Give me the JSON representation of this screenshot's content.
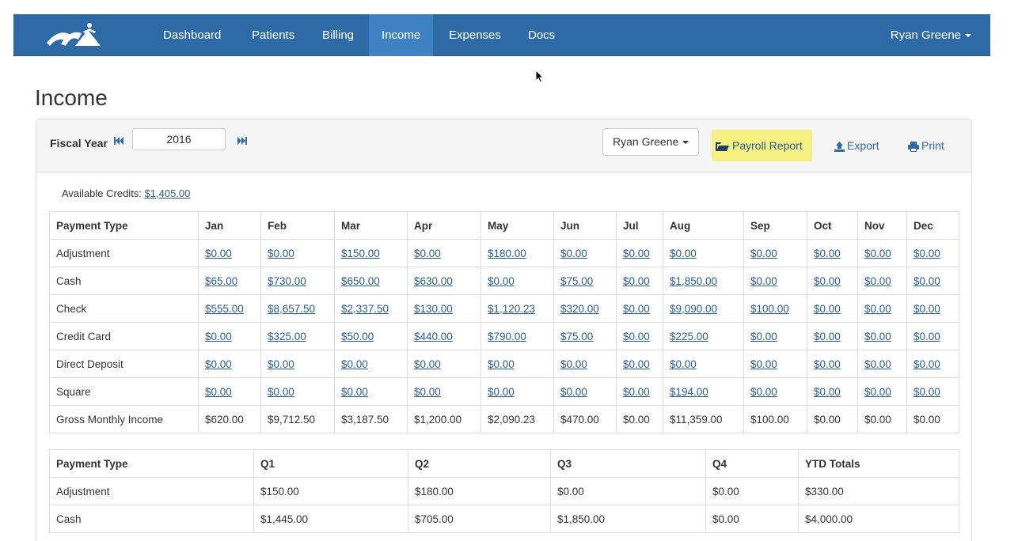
{
  "nav": {
    "items": [
      {
        "label": "Dashboard",
        "active": false
      },
      {
        "label": "Patients",
        "active": false
      },
      {
        "label": "Billing",
        "active": false
      },
      {
        "label": "Income",
        "active": true
      },
      {
        "label": "Expenses",
        "active": false
      },
      {
        "label": "Docs",
        "active": false
      }
    ],
    "user": "Ryan Greene"
  },
  "page": {
    "title": "Income"
  },
  "toolbar": {
    "fiscal_year_label": "Fiscal Year",
    "fiscal_year_value": "2016",
    "user_select": "Ryan Greene",
    "payroll_label": "Payroll Report",
    "export_label": "Export",
    "print_label": "Print"
  },
  "credits": {
    "label": "Available Credits:",
    "value": "$1,405.00"
  },
  "monthly": {
    "headers": [
      "Payment Type",
      "Jan",
      "Feb",
      "Mar",
      "Apr",
      "May",
      "Jun",
      "Jul",
      "Aug",
      "Sep",
      "Oct",
      "Nov",
      "Dec"
    ],
    "rows": [
      {
        "type": "Adjustment",
        "values": [
          "$0.00",
          "$0.00",
          "$150.00",
          "$0.00",
          "$180.00",
          "$0.00",
          "$0.00",
          "$0.00",
          "$0.00",
          "$0.00",
          "$0.00",
          "$0.00"
        ]
      },
      {
        "type": "Cash",
        "values": [
          "$65.00",
          "$730.00",
          "$650.00",
          "$630.00",
          "$0.00",
          "$75.00",
          "$0.00",
          "$1,850.00",
          "$0.00",
          "$0.00",
          "$0.00",
          "$0.00"
        ]
      },
      {
        "type": "Check",
        "values": [
          "$555.00",
          "$8,657.50",
          "$2,337.50",
          "$130.00",
          "$1,120.23",
          "$320.00",
          "$0.00",
          "$9,090.00",
          "$100.00",
          "$0.00",
          "$0.00",
          "$0.00"
        ]
      },
      {
        "type": "Credit Card",
        "values": [
          "$0.00",
          "$325.00",
          "$50.00",
          "$440.00",
          "$790.00",
          "$75.00",
          "$0.00",
          "$225.00",
          "$0.00",
          "$0.00",
          "$0.00",
          "$0.00"
        ]
      },
      {
        "type": "Direct Deposit",
        "values": [
          "$0.00",
          "$0.00",
          "$0.00",
          "$0.00",
          "$0.00",
          "$0.00",
          "$0.00",
          "$0.00",
          "$0.00",
          "$0.00",
          "$0.00",
          "$0.00"
        ]
      },
      {
        "type": "Square",
        "values": [
          "$0.00",
          "$0.00",
          "$0.00",
          "$0.00",
          "$0.00",
          "$0.00",
          "$0.00",
          "$194.00",
          "$0.00",
          "$0.00",
          "$0.00",
          "$0.00"
        ]
      }
    ],
    "gross": {
      "type": "Gross Monthly Income",
      "values": [
        "$620.00",
        "$9,712.50",
        "$3,187.50",
        "$1,200.00",
        "$2,090.23",
        "$470.00",
        "$0.00",
        "$11,359.00",
        "$100.00",
        "$0.00",
        "$0.00",
        "$0.00"
      ]
    }
  },
  "quarterly": {
    "headers": [
      "Payment Type",
      "Q1",
      "Q2",
      "Q3",
      "Q4",
      "YTD Totals"
    ],
    "rows": [
      {
        "type": "Adjustment",
        "values": [
          "$150.00",
          "$180.00",
          "$0.00",
          "$0.00",
          "$330.00"
        ]
      },
      {
        "type": "Cash",
        "values": [
          "$1,445.00",
          "$705.00",
          "$1,850.00",
          "$0.00",
          "$4,000.00"
        ]
      }
    ]
  }
}
